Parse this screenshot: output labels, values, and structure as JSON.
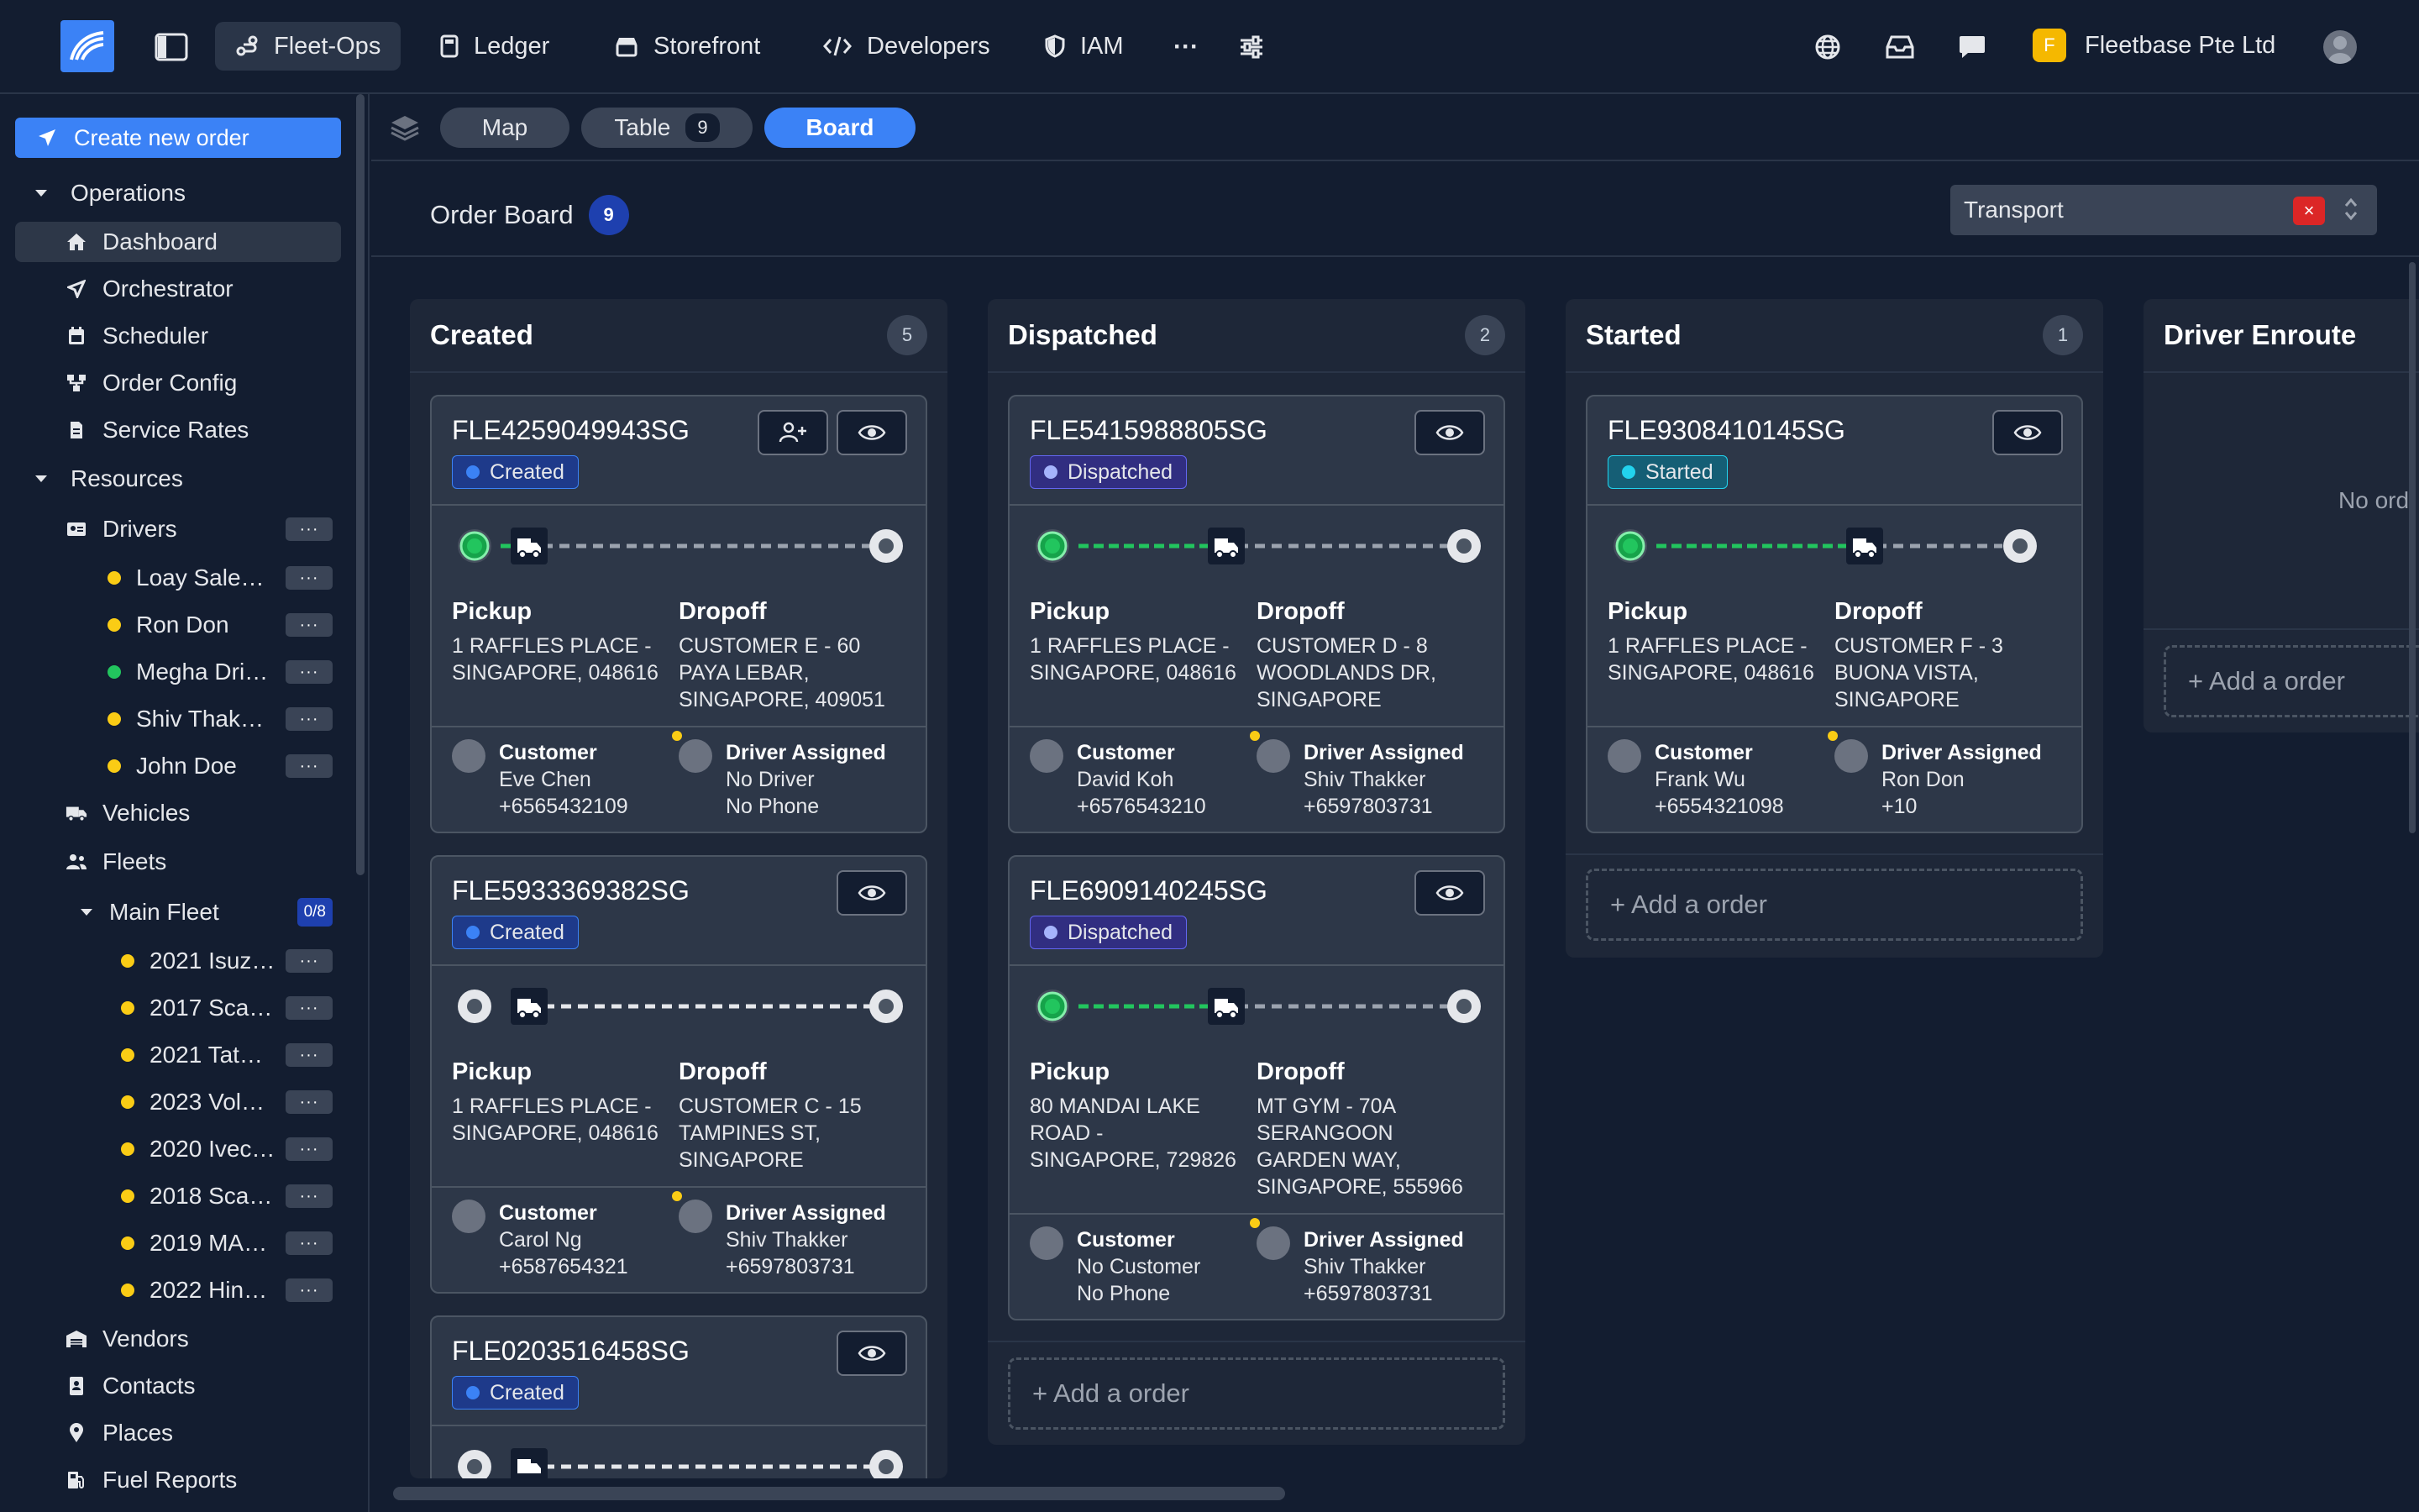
{
  "topbar": {
    "nav": [
      {
        "label": "Fleet-Ops",
        "icon": "route-icon",
        "active": true
      },
      {
        "label": "Ledger",
        "icon": "calculator-icon"
      },
      {
        "label": "Storefront",
        "icon": "store-icon"
      },
      {
        "label": "Developers",
        "icon": "code-icon"
      },
      {
        "label": "IAM",
        "icon": "shield-icon"
      }
    ],
    "more_label": "···",
    "org_initial": "F",
    "org_name": "Fleetbase Pte Ltd"
  },
  "sidebar": {
    "create_label": "Create new order",
    "operations_label": "Operations",
    "operations_items": [
      "Dashboard",
      "Orchestrator",
      "Scheduler",
      "Order Config",
      "Service Rates"
    ],
    "resources_label": "Resources",
    "drivers_label": "Drivers",
    "drivers": [
      {
        "name": "Loay Sale…",
        "status_color": "#facc15"
      },
      {
        "name": "Ron Don",
        "status_color": "#facc15"
      },
      {
        "name": "Megha Dri…",
        "status_color": "#22c55e"
      },
      {
        "name": "Shiv Thak…",
        "status_color": "#facc15"
      },
      {
        "name": "John Doe",
        "status_color": "#facc15"
      }
    ],
    "vehicles_label": "Vehicles",
    "fleets_label": "Fleets",
    "main_fleet_label": "Main Fleet",
    "main_fleet_badge": "0/8",
    "fleet_vehicles": [
      "2021 Isuz…",
      "2017 Sca…",
      "2021 Tat…",
      "2023 Vol…",
      "2020 Ivec…",
      "2018 Sca…",
      "2019 MA…",
      "2022 Hin…"
    ],
    "more_items": [
      "Vendors",
      "Contacts",
      "Places",
      "Fuel Reports"
    ],
    "dots": "···"
  },
  "viewbar": {
    "map_label": "Map",
    "table_label": "Table",
    "table_count": "9",
    "board_label": "Board"
  },
  "board_header": {
    "title": "Order Board",
    "count": "9",
    "select_value": "Transport",
    "clear_label": "×"
  },
  "columns": [
    {
      "title": "Created",
      "count": "5"
    },
    {
      "title": "Dispatched",
      "count": "2"
    },
    {
      "title": "Started",
      "count": "1"
    },
    {
      "title": "Driver Enroute",
      "empty_text": "No ord"
    }
  ],
  "labels": {
    "pickup": "Pickup",
    "dropoff": "Dropoff",
    "customer": "Customer",
    "driver_assigned": "Driver Assigned",
    "add_order": "+ Add a order"
  },
  "cards": [
    {
      "id": "FLE4259049943SG",
      "status": "Created",
      "pickup": "1 RAFFLES PLACE - SINGAPORE, 048616",
      "dropoff": "CUSTOMER E - 60 PAYA LEBAR, SINGAPORE, 409051",
      "customer_name": "Eve Chen",
      "customer_phone": "+6565432109",
      "driver_name": "No Driver",
      "driver_phone": "No Phone"
    },
    {
      "id": "FLE5933369382SG",
      "status": "Created",
      "pickup": "1 RAFFLES PLACE - SINGAPORE, 048616",
      "dropoff": "CUSTOMER C - 15 TAMPINES ST, SINGAPORE",
      "customer_name": "Carol Ng",
      "customer_phone": "+6587654321",
      "driver_name": "Shiv Thakker",
      "driver_phone": "+6597803731"
    },
    {
      "id": "FLE0203516458SG",
      "status": "Created"
    },
    {
      "id": "FLE5415988805SG",
      "status": "Dispatched",
      "pickup": "1 RAFFLES PLACE - SINGAPORE, 048616",
      "dropoff": "CUSTOMER D - 8 WOODLANDS DR, SINGAPORE",
      "customer_name": "David Koh",
      "customer_phone": "+6576543210",
      "driver_name": "Shiv Thakker",
      "driver_phone": "+6597803731"
    },
    {
      "id": "FLE6909140245SG",
      "status": "Dispatched",
      "pickup": "80 MANDAI LAKE ROAD - SINGAPORE, 729826",
      "dropoff": "MT GYM - 70A SERANGOON GARDEN WAY, SINGAPORE, 555966",
      "customer_name": "No Customer",
      "customer_phone": "No Phone",
      "driver_name": "Shiv Thakker",
      "driver_phone": "+6597803731"
    },
    {
      "id": "FLE9308410145SG",
      "status": "Started",
      "pickup": "1 RAFFLES PLACE - SINGAPORE, 048616",
      "dropoff": "CUSTOMER F - 3 BUONA VISTA, SINGAPORE",
      "customer_name": "Frank Wu",
      "customer_phone": "+6554321098",
      "driver_name": "Ron Don",
      "driver_phone": "+10"
    }
  ],
  "colors": {
    "accent": "#3b82f6",
    "created": "#3b82f6",
    "dispatched": "#a5b4fc",
    "started": "#22d3ee",
    "progress": "#22c55e"
  }
}
